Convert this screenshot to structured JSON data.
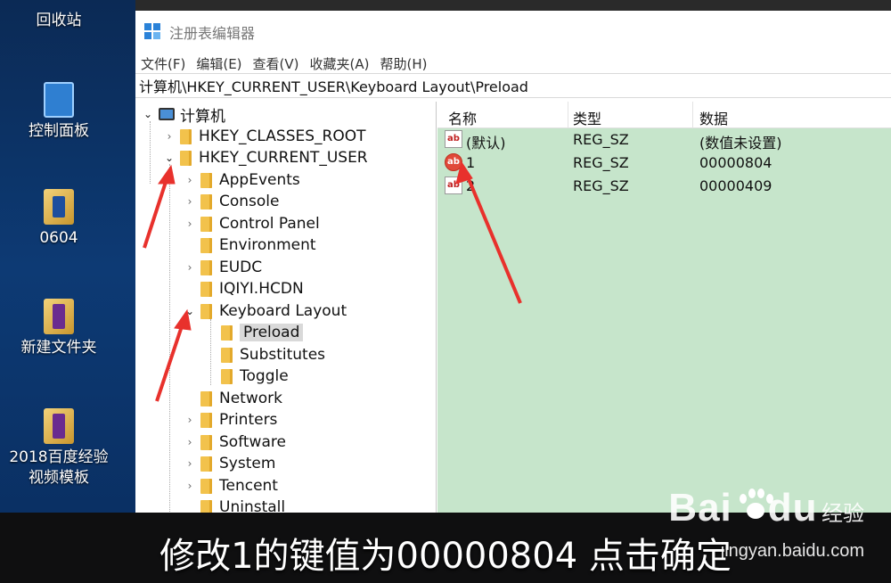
{
  "desktop": {
    "icons": [
      {
        "label": "回收站",
        "icon": "recycle-bin-icon"
      },
      {
        "label": "控制面板",
        "icon": "control-panel-icon"
      },
      {
        "label": "0604",
        "icon": "document-folder-icon"
      },
      {
        "label": "新建文件夹",
        "icon": "folder-icon"
      },
      {
        "label": "2018百度经验视频模板",
        "icon": "folder-icon"
      }
    ]
  },
  "window": {
    "title": "注册表编辑器",
    "menu": [
      "文件(F)",
      "编辑(E)",
      "查看(V)",
      "收藏夹(A)",
      "帮助(H)"
    ],
    "address": "计算机\\HKEY_CURRENT_USER\\Keyboard Layout\\Preload"
  },
  "tree": {
    "root": "计算机",
    "hives": [
      "HKEY_CLASSES_ROOT",
      "HKEY_CURRENT_USER"
    ],
    "hkcu_children": [
      "AppEvents",
      "Console",
      "Control Panel",
      "Environment",
      "EUDC",
      "IQIYI.HCDN",
      "Keyboard Layout",
      "Network",
      "Printers",
      "Software",
      "System",
      "Tencent",
      "Uninstall"
    ],
    "keyboard_children": [
      "Preload",
      "Substitutes",
      "Toggle"
    ],
    "selected": "Preload"
  },
  "values": {
    "headers": {
      "name": "名称",
      "type": "类型",
      "data": "数据"
    },
    "rows": [
      {
        "name": "(默认)",
        "type": "REG_SZ",
        "data": "(数值未设置)"
      },
      {
        "name": "1",
        "type": "REG_SZ",
        "data": "00000804"
      },
      {
        "name": "2",
        "type": "REG_SZ",
        "data": "00000409"
      }
    ]
  },
  "caption": "修改1的键值为00000804 点击确定",
  "watermark": {
    "brand": "Bai",
    "brand2": "du",
    "sub": "经验",
    "url": "jingyan.baidu.com"
  },
  "colors": {
    "accent_arrow": "#e8312c",
    "values_bg": "#c6e5cb",
    "folder": "#f2c24c"
  }
}
